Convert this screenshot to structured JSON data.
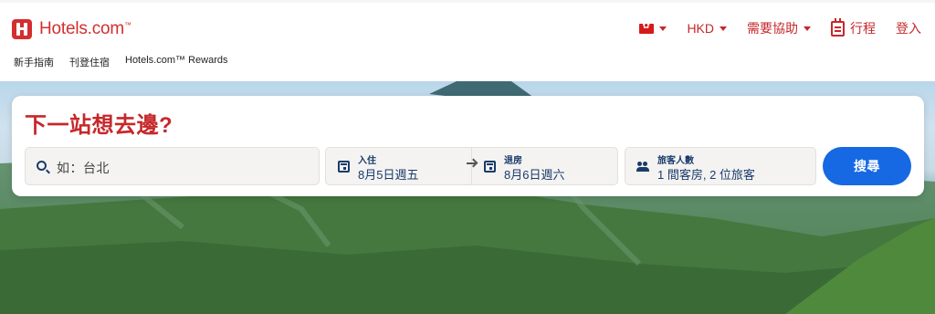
{
  "brand": {
    "name": "Hotels.com",
    "tm": "™"
  },
  "header": {
    "currency": "HKD",
    "help": "需要協助",
    "trips": "行程",
    "signin": "登入",
    "flag_icon": "hong-kong-flag-icon"
  },
  "subnav": [
    "新手指南",
    "刊登住宿",
    "Hotels.com™ Rewards"
  ],
  "search": {
    "title": "下一站想去邊?",
    "destination_placeholder": "如：台北",
    "checkin_label": "入住",
    "checkin_value": "8月5日週五",
    "checkout_label": "退房",
    "checkout_value": "8月6日週六",
    "guests_label": "旅客人數",
    "guests_value": "1 間客房, 2 位旅客",
    "button": "搜尋"
  },
  "colors": {
    "brand_red": "#c6282b",
    "button_blue": "#1668e3",
    "field_text": "#1a3b6b"
  }
}
